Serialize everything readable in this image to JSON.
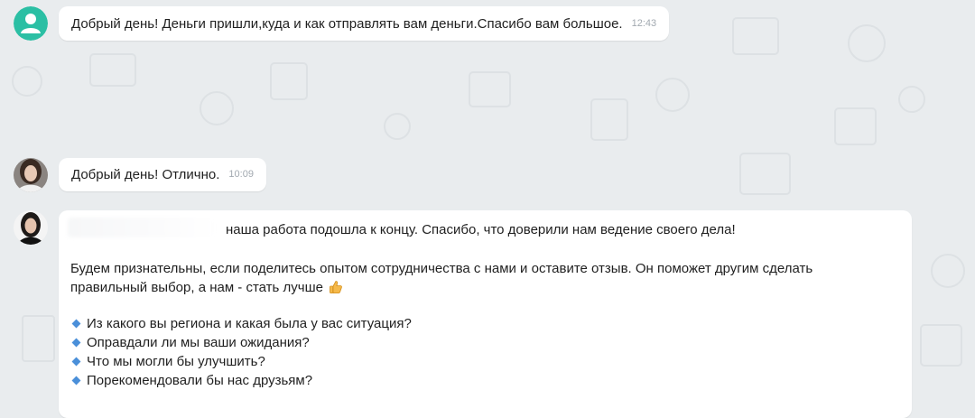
{
  "messages": [
    {
      "sender": "client",
      "text": "Добрый день! Деньги пришли,куда и как отправлять вам деньги.Спасибо вам большое.",
      "time": "12:43"
    },
    {
      "sender": "agent",
      "text": "Добрый день! Отлично.",
      "time": "10:09"
    },
    {
      "sender": "agent",
      "paragraph1": "наша работа подошла к концу. Спасибо, что доверили нам ведение своего дела!",
      "paragraph2": "Будем признательны, если поделитесь опытом сотрудничества с нами и оставите отзыв. Он поможет другим сделать правильный выбор, а нам - стать лучше",
      "questions": [
        "Из какого вы региона и какая была у вас ситуация?",
        "Оправдали ли мы ваши ожидания?",
        "Что мы могли бы улучшить?",
        "Порекомендовали бы нас друзьям?"
      ]
    }
  ],
  "icons": {
    "default_avatar": "person-icon",
    "thumbs_up": "thumbs-up-emoji"
  },
  "colors": {
    "background": "#e9ecee",
    "bubble": "#ffffff",
    "default_avatar": "#2bbfa4",
    "bullet": "#4a8fd9",
    "time": "#a2a9b0"
  }
}
